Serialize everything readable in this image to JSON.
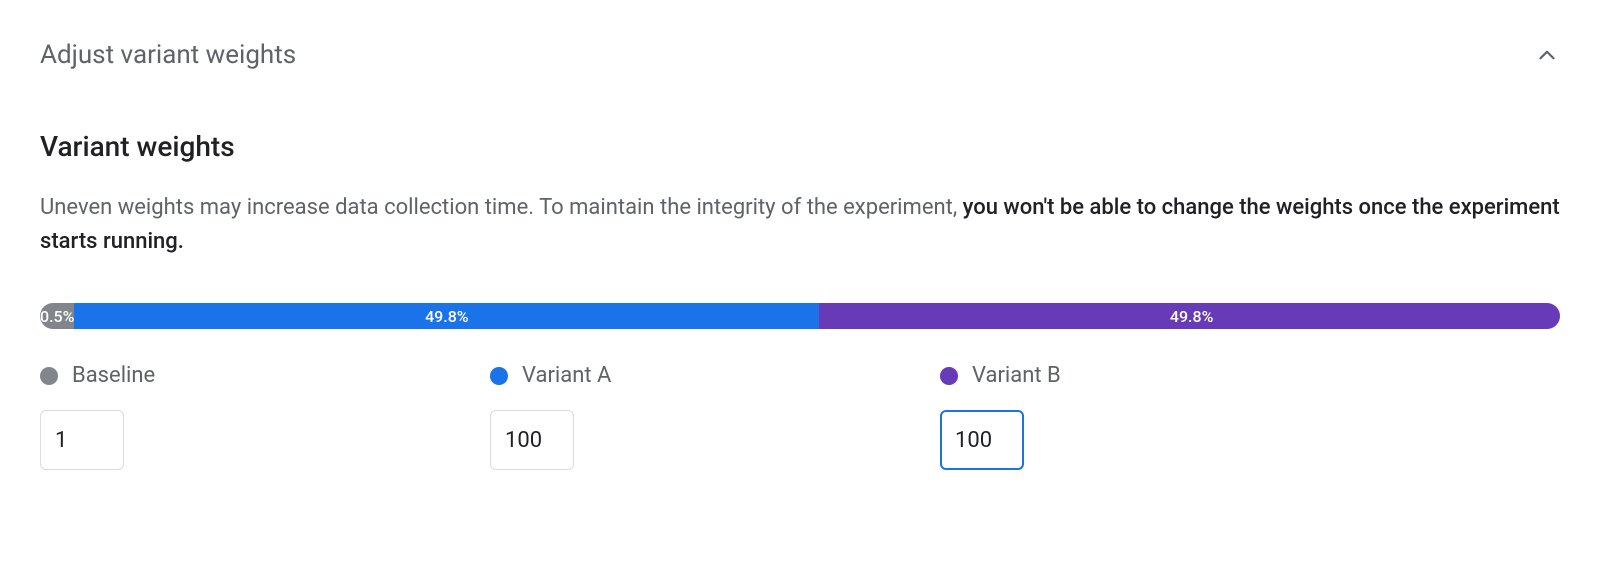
{
  "section": {
    "title": "Adjust variant weights"
  },
  "heading": "Variant weights",
  "description": {
    "normal": "Uneven weights may increase data collection time. To maintain the integrity of the experiment, ",
    "strong": "you won't be able to change the weights once the experiment starts running."
  },
  "bar": {
    "baseline": {
      "width_pct": 2.0,
      "label": "0.5%"
    },
    "variantA": {
      "width_pct": 49.0,
      "label": "49.8%"
    },
    "variantB": {
      "width_pct": 49.0,
      "label": "49.8%"
    }
  },
  "variants": {
    "baseline": {
      "label": "Baseline",
      "value": "1",
      "color": "#80868b"
    },
    "variantA": {
      "label": "Variant A",
      "value": "100",
      "color": "#1a73e8"
    },
    "variantB": {
      "label": "Variant B",
      "value": "100",
      "color": "#673ab7"
    }
  }
}
